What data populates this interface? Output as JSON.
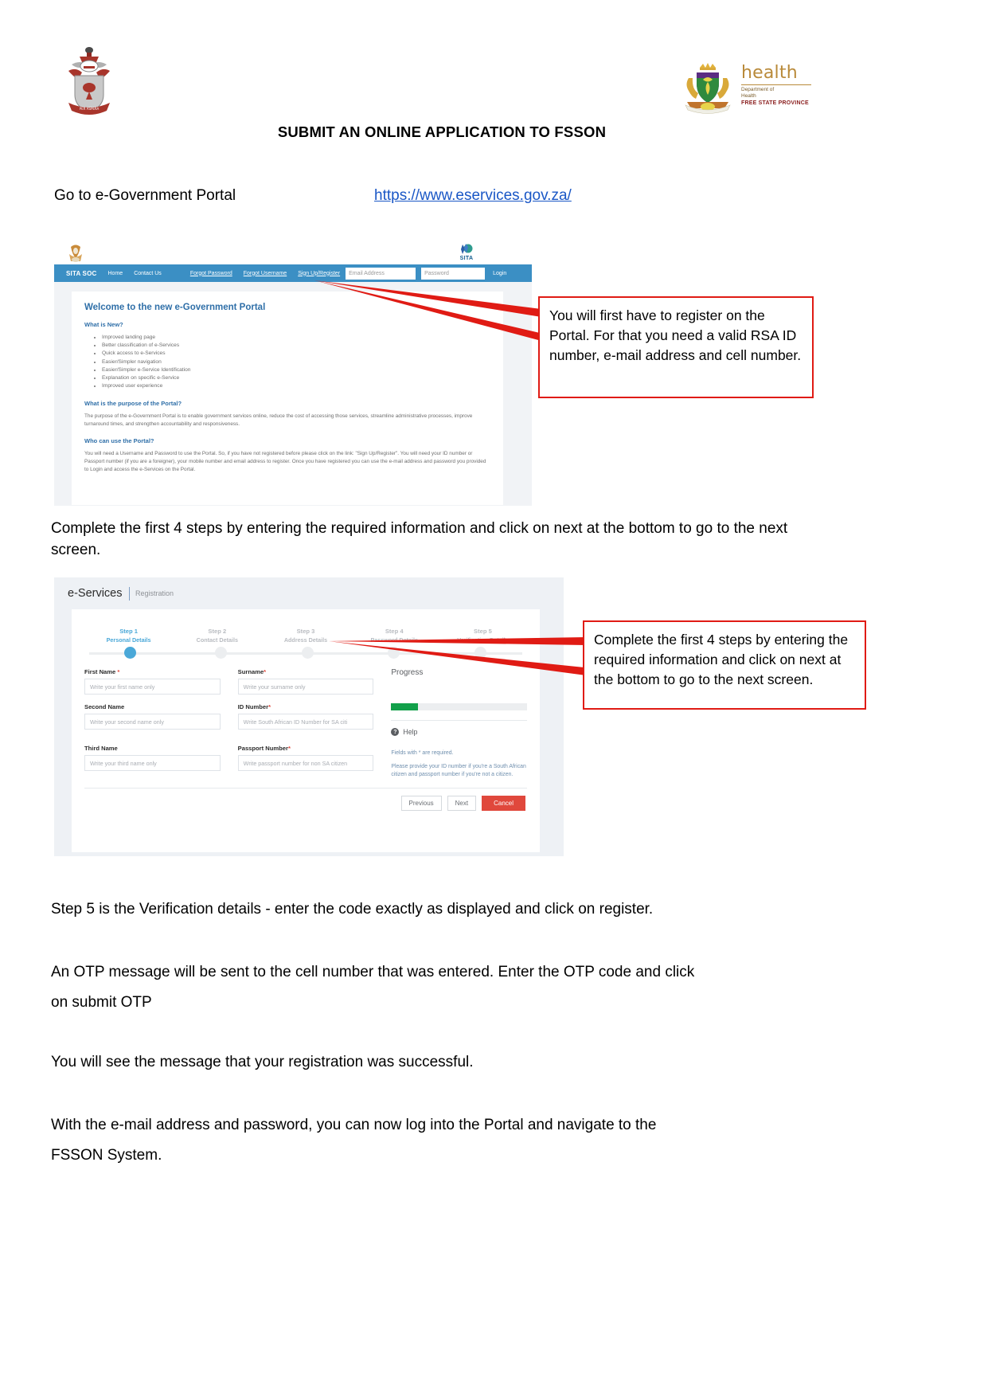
{
  "header": {
    "title": "SUBMIT AN ONLINE APPLICATION TO FSSON",
    "health_logo": {
      "wordmark": "health",
      "line1": "Department of",
      "line2": "Health",
      "province": "FREE STATE PROVINCE"
    }
  },
  "intro": {
    "label": "Go to e-Government Portal",
    "url": "https://www.eservices.gov.za/"
  },
  "portal_screenshot": {
    "sita_logo_text": "SITA",
    "nav": {
      "brand": "SITA SOC",
      "home": "Home",
      "contact": "Contact Us",
      "forgot_password": "Forgot Password",
      "forgot_username": "Forgot Username",
      "signup": "Sign Up/Register",
      "email_placeholder": "Email Address",
      "password_placeholder": "Password",
      "login": "Login"
    },
    "heading": "Welcome to the new e-Government Portal",
    "whats_new_heading": "What is New?",
    "whats_new": [
      "Improved landing page",
      "Better classification of e-Services",
      "Quick access to e-Services",
      "Easier/Simpler navigation",
      "Easier/Simpler e-Service Identification",
      "Explanation on specific e-Service",
      "Improved user experience"
    ],
    "purpose_heading": "What is the purpose of the Portal?",
    "purpose_text": "The purpose of the e-Government Portal is to enable government services online, reduce the cost of accessing those services, streamline administrative processes, improve turnaround times, and strengthen accountability and responsiveness.",
    "who_heading": "Who can use the Portal?",
    "who_text": "You will need a Username and Password to use the Portal. So, if you have not registered before please click on the link: \"Sign Up/Register\". You will need your ID number or Passport number (if you are a foreigner), your mobile number and email address to register. Once you have registered you can use the e-mail address and password you provided to Login and access the e-Services on the Portal."
  },
  "callout_1": "You will first have to register on the Portal.  For that you need a valid RSA ID number, e-mail address and cell number.",
  "instruction_1": "Complete the first 4 steps by entering the required information and click on next at the bottom to go to the next screen.",
  "callout_2": "Complete the first 4 steps by entering the required information and click on next at the bottom to go to the next screen.",
  "registration_screenshot": {
    "brand": "e-Services",
    "section": "Registration",
    "steps": [
      {
        "number": "Step 1",
        "label": "Personal Details",
        "active": true
      },
      {
        "number": "Step 2",
        "label": "Contact Details",
        "active": false
      },
      {
        "number": "Step 3",
        "label": "Address Details",
        "active": false
      },
      {
        "number": "Step 4",
        "label": "Password Details",
        "active": false
      },
      {
        "number": "Step 5",
        "label": "Verification Details",
        "active": false
      }
    ],
    "fields": [
      {
        "label": "First Name",
        "required": true,
        "placeholder": "Write your first name only"
      },
      {
        "label": "Surname",
        "required": true,
        "placeholder": "Write your surname only"
      },
      {
        "label": "Second Name",
        "required": false,
        "placeholder": "Write your second name only"
      },
      {
        "label": "ID Number",
        "required": true,
        "placeholder": "Write South African ID Number for SA citi"
      },
      {
        "label": "Third Name",
        "required": false,
        "placeholder": "Write your third name only"
      },
      {
        "label": "Passport Number",
        "required": true,
        "placeholder": "Write passport number for non SA citizen"
      }
    ],
    "progress_label": "Progress",
    "progress_percent": 20,
    "progress_color": "#12a04a",
    "help_heading": "Help",
    "help_text_1": "Fields with * are required.",
    "help_text_2": "Please provide your ID number if you're a South African citizen and passport number if you're not a citizen.",
    "buttons": {
      "previous": "Previous",
      "next": "Next",
      "cancel": "Cancel"
    }
  },
  "paragraphs": {
    "step5": "Step 5 is the Verification details - enter the code exactly as displayed and click on register.",
    "otp_line1": "An OTP message will be sent to the cell number that was entered.  Enter the OTP code and click",
    "otp_line2": "on submit OTP",
    "success": "You will see the message that your registration was successful.",
    "login_line1": "With the e-mail address and password, you can now log into the Portal and navigate to the",
    "login_line2": "FSSON System."
  }
}
